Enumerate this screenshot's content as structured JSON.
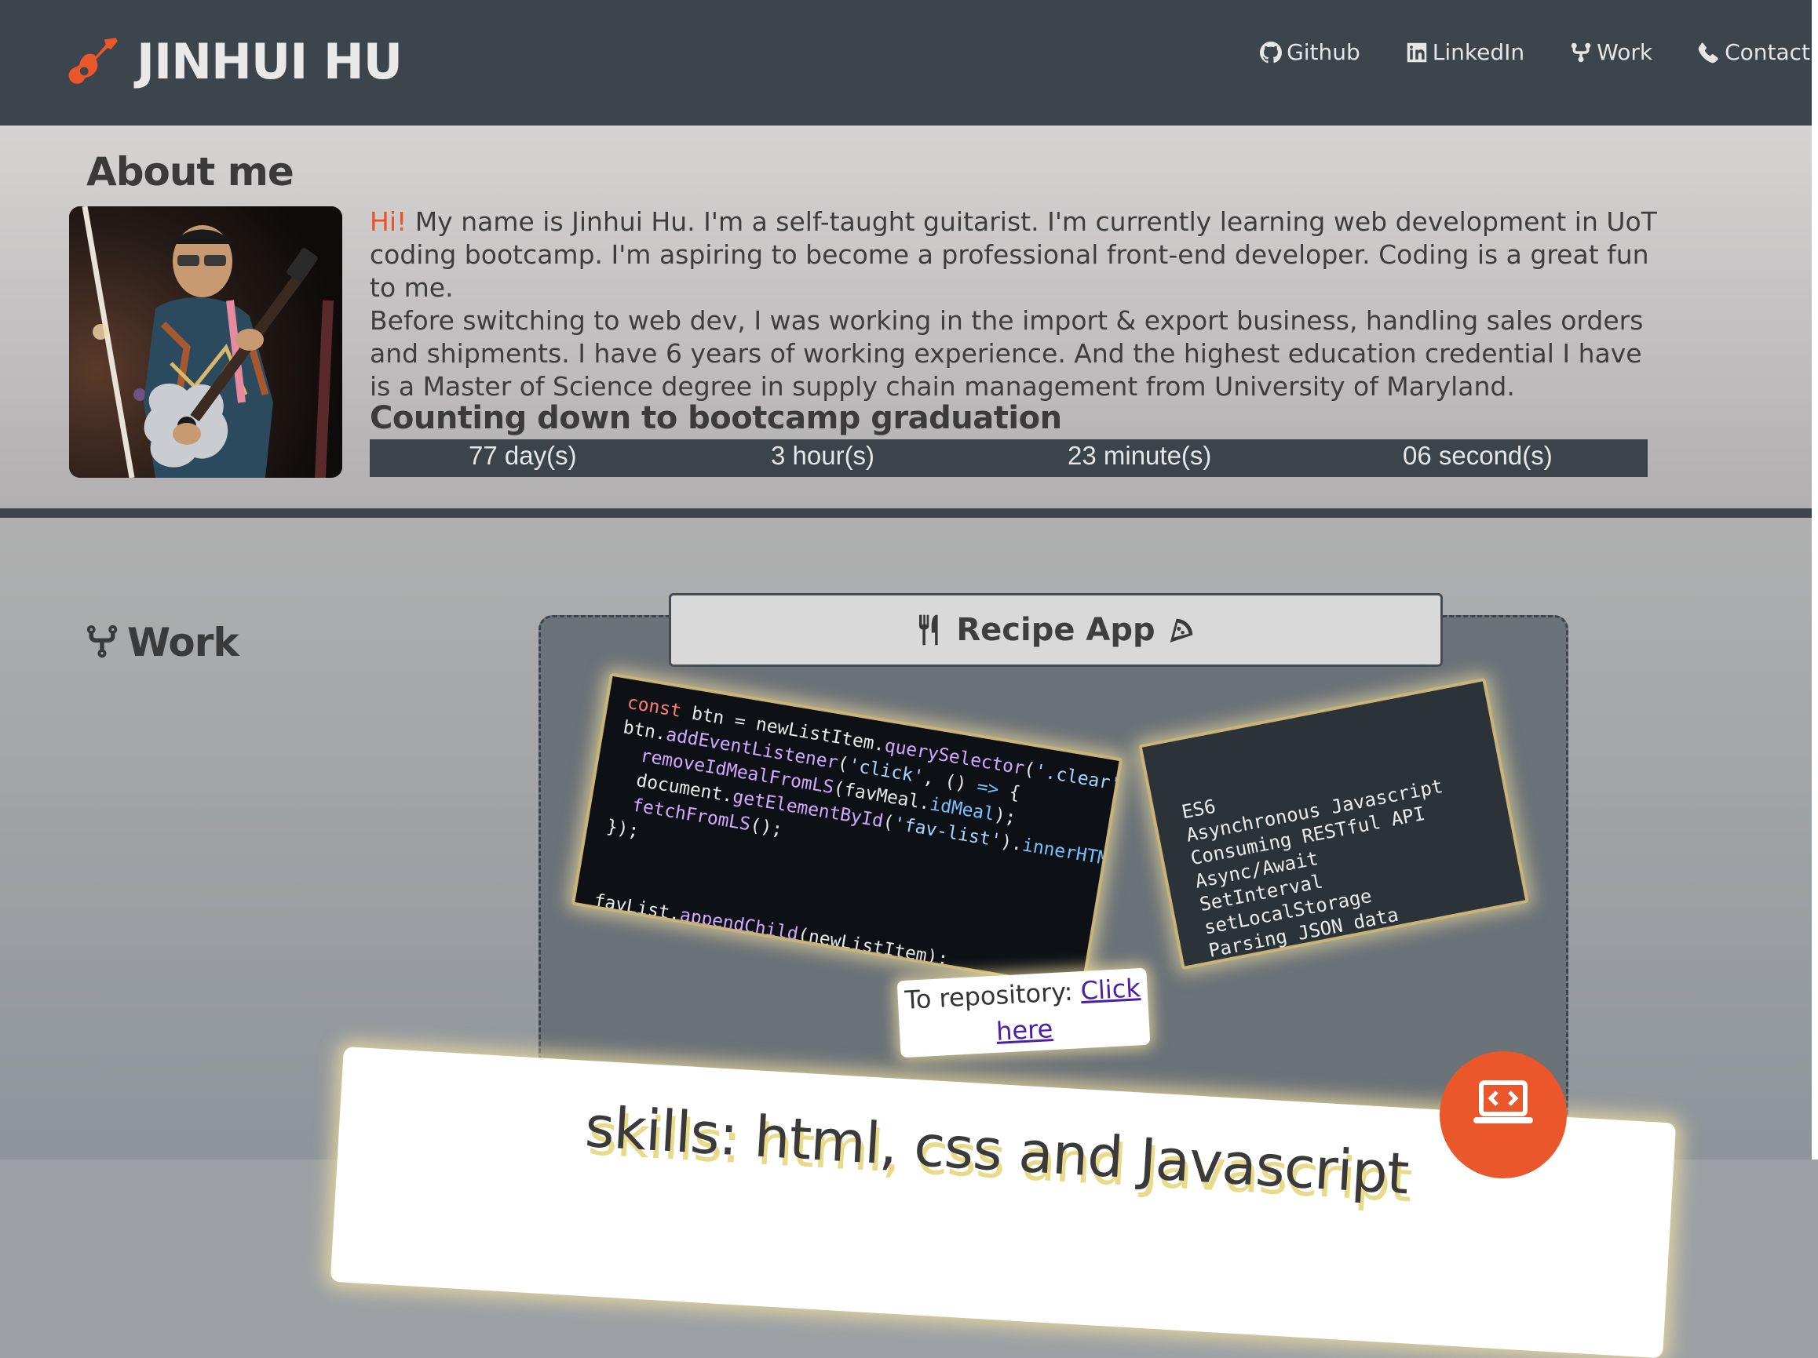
{
  "header": {
    "logo_text": "JINHUI HU",
    "nav": [
      {
        "label": "Github",
        "icon": "github-icon"
      },
      {
        "label": "LinkedIn",
        "icon": "linkedin-icon"
      },
      {
        "label": "Work",
        "icon": "code-fork-icon"
      },
      {
        "label": "Contact",
        "icon": "phone-icon"
      }
    ]
  },
  "about": {
    "title": "About me",
    "greeting": "Hi!",
    "bio_1": " My name is Jinhui Hu. I'm a self-taught guitarist. I'm currently learning web development in UoT coding bootcamp. I'm aspiring to become a professional front-end developer. Coding is a great fun to me.",
    "bio_2": "Before switching to web dev, I was working in the import & export business, handling sales orders and shipments. I have 6 years of working experience. And the highest education credential I have is a Master of Science degree in supply chain management from University of Maryland.",
    "countdown_title": "Counting down to bootcamp graduation",
    "countdown": {
      "days": "77 day(s)",
      "hours": "3 hour(s)",
      "minutes": "23 minute(s)",
      "seconds": "06 second(s)"
    }
  },
  "work": {
    "title": "Work",
    "project": {
      "title": "Recipe App",
      "skills": [
        "ES6",
        "Asynchronous Javascript",
        "Consuming RESTful API",
        "Async/Await",
        "SetInterval",
        "setLocalStorage",
        "Parsing JSON data"
      ],
      "repo_prefix": "To repository: ",
      "repo_link": "Click here"
    },
    "skills_banner": "skills: html, css and Javascript"
  },
  "colors": {
    "accent": "#e9572a",
    "header_bg": "#3c444c",
    "link": "#4b1ea8"
  }
}
